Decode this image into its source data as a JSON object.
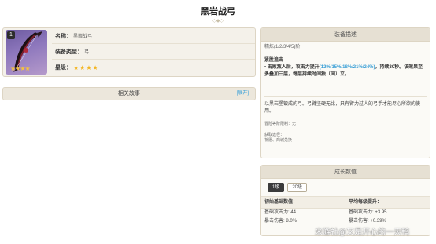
{
  "page": {
    "title": "黑岩战弓"
  },
  "info": {
    "level_badge": "1",
    "thumb_stars": "★★★★",
    "name_label": "名称：",
    "name_value": "黑岩战弓",
    "type_label": "装备类型：",
    "type_value": "弓",
    "rarity_label": "星级：",
    "rarity_stars": "★★★★"
  },
  "story": {
    "title": "相关故事",
    "expand": "[展开]"
  },
  "desc": {
    "header": "装备描述",
    "refine": "精炼(1/2/3/4/5)阶",
    "skill_name": "紧胜追击",
    "skill_desc_pre": "• 击败敌人后，攻击力提升",
    "skill_desc_values": "(12%/15%/18%/21%/24%)",
    "skill_desc_post": "，持续30秒。该效果至多叠加三层，每层持续时间独（",
    "skill_desc_tail": "同",
    "skill_desc_end": "）立。",
    "lore": "以黑岩堡锻成的弓。弓臂坚硬无比，只有臂力过人的弓手才能尽心所欲的使用。",
    "obtain_label": "冒险等阶限制：无",
    "source_label": "获取途径：",
    "source_value": "祈愿、商城兑换"
  },
  "growth": {
    "header": "成长数值",
    "levels": [
      "1级",
      "20级"
    ],
    "left_head": "初始基础数值：",
    "right_head": "平均每级提升：",
    "left_lines": [
      "基础攻击力: 44",
      "暴击伤害: 8.0%"
    ],
    "right_lines": [
      "基础攻击力: +3.95",
      "暴击伤害: +0.39%"
    ]
  },
  "watermark": "米游社@又是开心的一天鸭",
  "colors": {
    "accent": "#3a9fd6",
    "star": "#f3b521",
    "panel_header": "#e6e0d3"
  }
}
